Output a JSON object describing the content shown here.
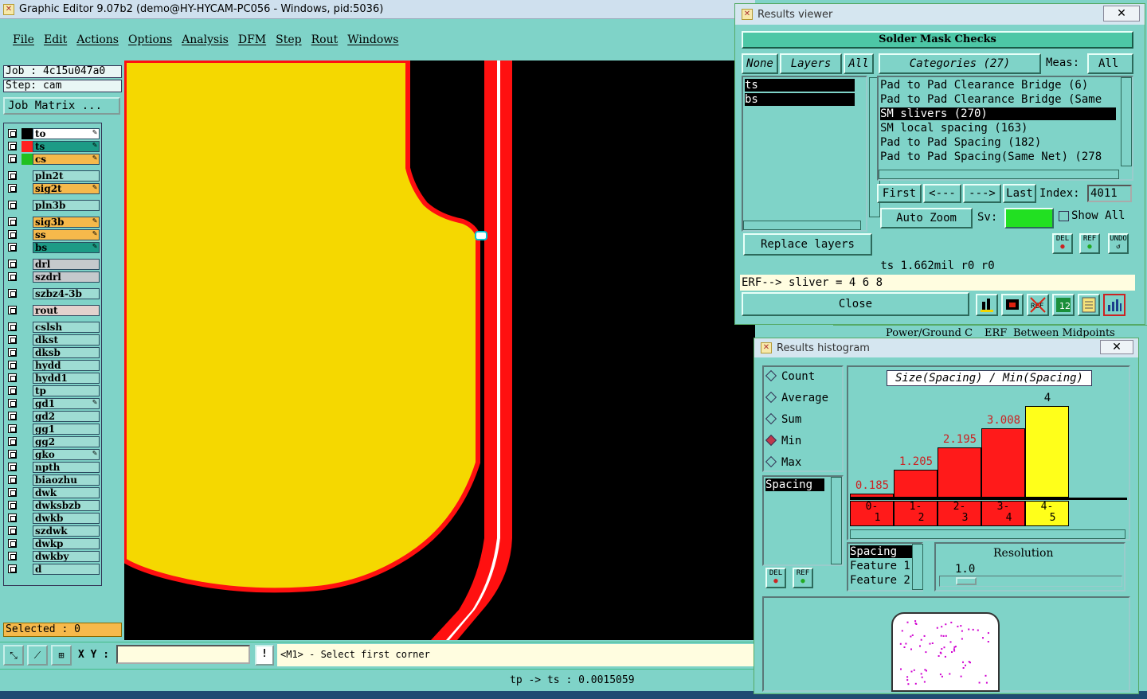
{
  "main": {
    "title": "Graphic Editor 9.07b2 (demo@HY-HYCAM-PC056 - Windows, pid:5036)",
    "menu": [
      "File",
      "Edit",
      "Actions",
      "Options",
      "Analysis",
      "DFM",
      "Step",
      "Rout",
      "Windows"
    ],
    "job": "Job : 4c15u047a0",
    "step": "Step: cam",
    "job_matrix": "Job Matrix ...",
    "layers": [
      {
        "name": "to",
        "color": "#ffffff",
        "swatch": "#000000",
        "edit": true
      },
      {
        "name": "ts",
        "color": "#1d9b86",
        "swatch": "#ff2020",
        "edit": true,
        "active": true
      },
      {
        "name": "cs",
        "color": "#f6b94b",
        "swatch": "#20c020",
        "edit": true
      },
      {
        "name": "pln2t",
        "color": "#9edcd3"
      },
      {
        "name": "sig2t",
        "color": "#f6b94b",
        "edit": true
      },
      {
        "name": "pln3b",
        "color": "#9edcd3"
      },
      {
        "name": "sig3b",
        "color": "#f6b94b",
        "edit": true
      },
      {
        "name": "ss",
        "color": "#f6b94b",
        "edit": true
      },
      {
        "name": "bs",
        "color": "#1d9b86",
        "edit": true
      },
      {
        "name": "drl",
        "color": "#c5c9cc"
      },
      {
        "name": "szdrl",
        "color": "#c5c9cc"
      },
      {
        "name": "szbz4-3b",
        "color": "#9edcd3"
      },
      {
        "name": "rout",
        "color": "#e3d2cd"
      },
      {
        "name": "cslsh",
        "color": "#9edcd3"
      },
      {
        "name": "dkst",
        "color": "#9edcd3"
      },
      {
        "name": "dksb",
        "color": "#9edcd3"
      },
      {
        "name": "hydd",
        "color": "#9edcd3"
      },
      {
        "name": "hydd1",
        "color": "#9edcd3"
      },
      {
        "name": "tp",
        "color": "#9edcd3"
      },
      {
        "name": "gd1",
        "color": "#9edcd3",
        "edit": true
      },
      {
        "name": "gd2",
        "color": "#9edcd3"
      },
      {
        "name": "gg1",
        "color": "#9edcd3"
      },
      {
        "name": "gg2",
        "color": "#9edcd3"
      },
      {
        "name": "gko",
        "color": "#9edcd3",
        "edit": true
      },
      {
        "name": "npth",
        "color": "#9edcd3"
      },
      {
        "name": "biaozhu",
        "color": "#9edcd3"
      },
      {
        "name": "dwk",
        "color": "#9edcd3"
      },
      {
        "name": "dwksbzb",
        "color": "#9edcd3"
      },
      {
        "name": "dwkb",
        "color": "#9edcd3"
      },
      {
        "name": "szdwk",
        "color": "#9edcd3"
      },
      {
        "name": "dwkp",
        "color": "#9edcd3"
      },
      {
        "name": "dwkby",
        "color": "#9edcd3"
      },
      {
        "name": "d",
        "color": "#9edcd3"
      }
    ],
    "selected": "Selected : 0",
    "xy_label": "X Y :",
    "xy_value": "",
    "prompt": "<M1> - Select first corner",
    "status": "tp -> ts : 0.0015059"
  },
  "results_viewer": {
    "title": "Results viewer",
    "header": "Solder Mask Checks",
    "btn_none": "None",
    "btn_layers": "Layers",
    "btn_all": "All",
    "categories_label": "Categories (27)",
    "meas_label": "Meas:",
    "meas_value": "All",
    "layer_list": [
      "ts",
      "bs"
    ],
    "categories": [
      "Pad to Pad Clearance Bridge (6)",
      "Pad to Pad Clearance Bridge (Same",
      "SM slivers (270)",
      "SM local spacing (163)",
      "Pad to Pad Spacing (182)",
      "Pad to Pad Spacing(Same Net) (278"
    ],
    "nav": [
      "First",
      "<---",
      "--->",
      "Last"
    ],
    "index_label": "Index:",
    "index_value": "4011",
    "auto_zoom": "Auto Zoom",
    "sv_label": "Sv:",
    "show_all": "Show All",
    "replace_layers": "Replace layers",
    "icon_del": "DEL",
    "icon_ref": "REF",
    "icon_undo": "UNDO",
    "status_line": "ts 1.662mil  r0  r0",
    "erf_line": "ERF--> sliver = 4 6 8",
    "close": "Close"
  },
  "background_tabs": [
    "Power/Ground C",
    "ERF",
    "Between Midpoints"
  ],
  "histogram": {
    "title": "Results histogram",
    "modes": [
      "Count",
      "Average",
      "Sum",
      "Min",
      "Max"
    ],
    "selected_mode": "Min",
    "chart_title": "Size(Spacing) / Min(Spacing)",
    "field_list": [
      "Spacing"
    ],
    "icon_del": "DEL",
    "icon_ref": "REF",
    "attr_list": [
      "Spacing",
      "Feature 1",
      "Feature 2"
    ],
    "resolution_label": "Resolution",
    "resolution_value": "1.0",
    "chart_data": {
      "type": "bar",
      "title": "Size(Spacing) / Min(Spacing)",
      "categories": [
        "0-1",
        "1-2",
        "2-3",
        "3-4",
        "4-5"
      ],
      "values": [
        0.185,
        1.205,
        2.195,
        3.008,
        4
      ],
      "value_labels": [
        "0.185",
        "1.205",
        "2.195",
        "3.008",
        "4"
      ],
      "bucket_labels": [
        [
          "0-",
          "1"
        ],
        [
          "1-",
          "2"
        ],
        [
          "2-",
          "3"
        ],
        [
          "3-",
          "4"
        ],
        [
          "4-",
          "5"
        ]
      ],
      "colors": [
        "#ff1a1a",
        "#ff1a1a",
        "#ff1a1a",
        "#ff1a1a",
        "#ffff1a"
      ],
      "ylim": [
        0,
        4.3
      ]
    }
  }
}
